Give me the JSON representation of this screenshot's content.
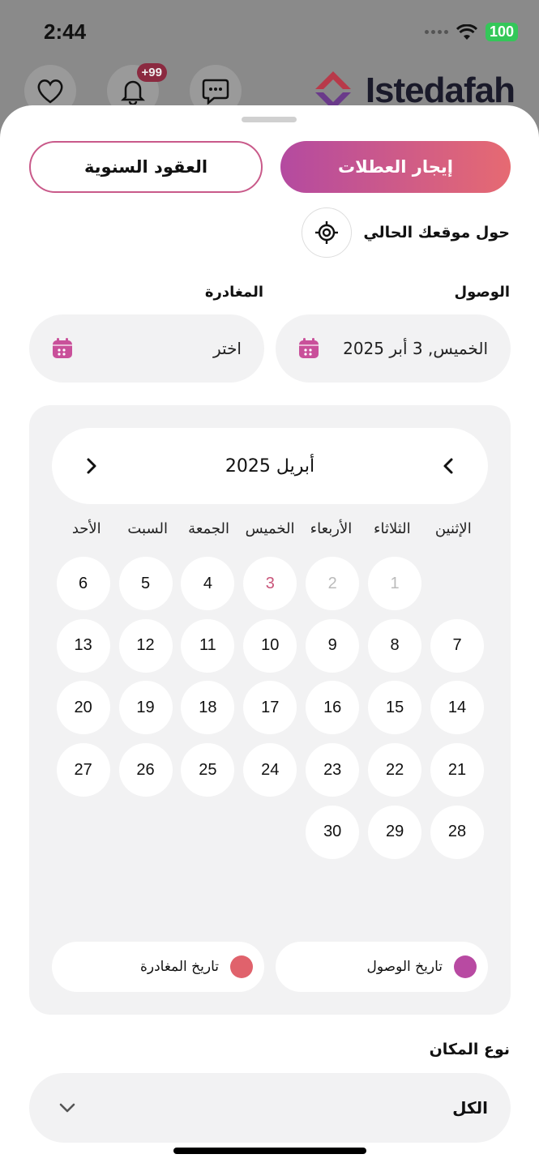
{
  "status_bar": {
    "time": "2:44",
    "battery": "100"
  },
  "background": {
    "notification_count": "+99",
    "logo_text": "Istedafah"
  },
  "tabs": {
    "active_label": "إيجار العطلات",
    "inactive_label": "العقود السنوية"
  },
  "nearby": {
    "label": "حول موقعك الحالي",
    "icon": "target-icon"
  },
  "arrival": {
    "label": "الوصول",
    "value": "الخميس, 3 أبر 2025"
  },
  "departure": {
    "label": "المغادرة",
    "value": "اختر"
  },
  "calendar": {
    "month_title": "أبريل 2025",
    "weekdays": [
      "الإثنين",
      "الثلاثاء",
      "الأربعاء",
      "الخميس",
      "الجمعة",
      "السبت",
      "الأحد"
    ],
    "weeks": [
      [
        "",
        "1",
        "2",
        "3",
        "4",
        "5",
        "6"
      ],
      [
        "7",
        "8",
        "9",
        "10",
        "11",
        "12",
        "13"
      ],
      [
        "14",
        "15",
        "16",
        "17",
        "18",
        "19",
        "20"
      ],
      [
        "21",
        "22",
        "23",
        "24",
        "25",
        "26",
        "27"
      ],
      [
        "28",
        "29",
        "30",
        "",
        "",
        "",
        ""
      ]
    ],
    "past_days": [
      "1",
      "2"
    ],
    "selected_day": "3",
    "legend": {
      "arrival_label": "تاريخ الوصول",
      "departure_label": "تاريخ المغادرة"
    }
  },
  "place_type": {
    "label": "نوع المكان",
    "value": "الكل"
  },
  "colors": {
    "accent_start": "#b44aa0",
    "accent_end": "#e66a72",
    "arrival_dot": "#b84aa2",
    "departure_dot": "#e0626c",
    "calendar_icon": "#c9509a"
  }
}
